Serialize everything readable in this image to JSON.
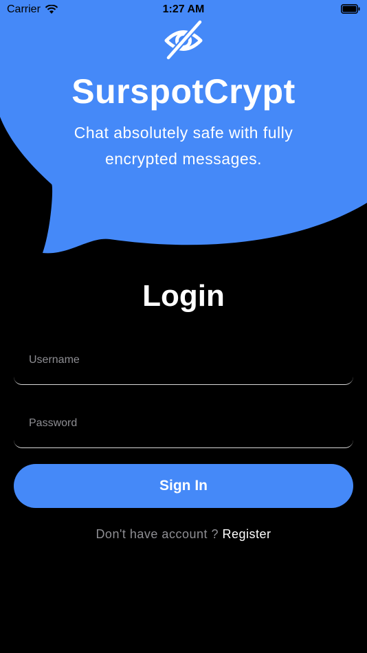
{
  "status_bar": {
    "carrier": "Carrier",
    "time": "1:27 AM",
    "wifi_icon": "wifi-icon",
    "battery_icon": "battery-icon"
  },
  "header": {
    "logo_icon": "eye-slash-icon",
    "title": "SurspotCrypt",
    "tagline": "Chat absolutely safe with fully encrypted messages.",
    "bubble_color": "#4589f8"
  },
  "login": {
    "heading": "Login",
    "username_placeholder": "Username",
    "username_value": "",
    "password_placeholder": "Password",
    "password_value": "",
    "sign_in_label": "Sign In",
    "no_account_prompt": "Don't have account ?",
    "register_label": "Register"
  },
  "colors": {
    "background": "#000000",
    "accent": "#4589f8",
    "muted_text": "#8e8e93"
  }
}
